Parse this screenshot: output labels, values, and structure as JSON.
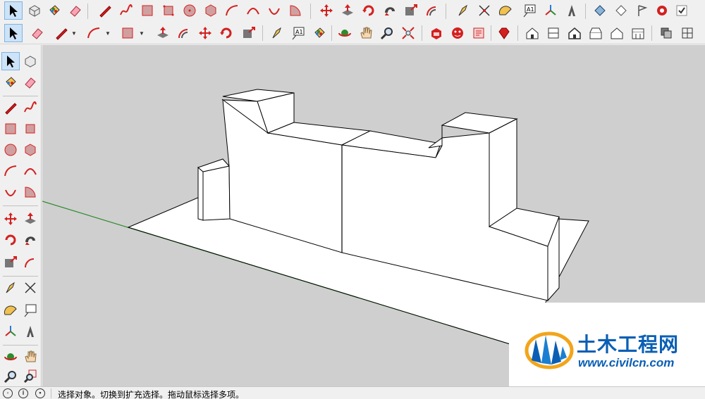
{
  "status": {
    "text": "选择对象。切换到扩充选择。拖动鼠标选择多项。"
  },
  "watermark": {
    "title": "土木工程网",
    "url": "www.civilcn.com"
  },
  "toolbar": {
    "text_tool_glyph": "A1",
    "axes_glyph": "A1"
  },
  "colors": {
    "accent_red": "#d42020",
    "highlight": "#cde3f7",
    "viewport_bg": "#cfcfcf",
    "green_axis": "#2e8b2e",
    "brand_blue": "#0a5fb5"
  }
}
